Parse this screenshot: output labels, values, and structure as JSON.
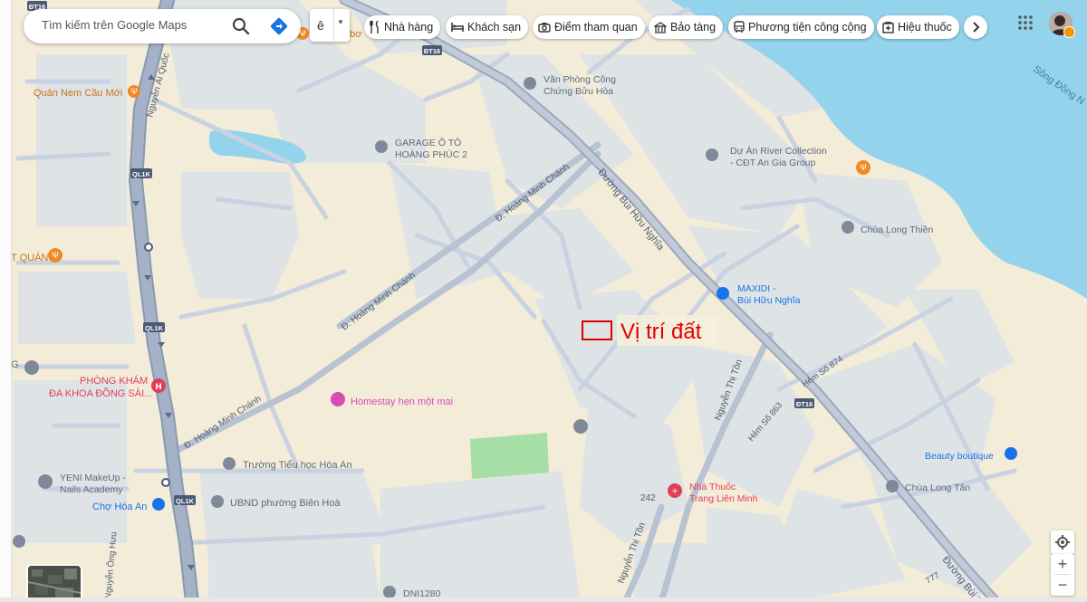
{
  "colors": {
    "land": "#f3ecd9",
    "block": "#dde3e6",
    "road": "#c9d2e0",
    "road_edge": "#b7c2d3",
    "highway": "#9aa8bd",
    "water": "#94d3ec",
    "park": "#a6dfa6",
    "poi_orange": "#f08a24",
    "poi_red": "#e23e57",
    "poi_blue": "#1a73e8",
    "poi_gray": "#7e8a99",
    "poi_pink": "#d84db3",
    "annotation": "#e00000"
  },
  "search": {
    "placeholder": "Tìm kiếm trên Google Maps"
  },
  "chips": [
    {
      "label": "Nhà hàng",
      "icon": "restaurant-icon"
    },
    {
      "label": "Khách sạn",
      "icon": "hotel-icon"
    },
    {
      "label": "Điểm tham quan",
      "icon": "camera-icon"
    },
    {
      "label": "Bảo tàng",
      "icon": "museum-icon"
    },
    {
      "label": "Phương tiện công cộng",
      "icon": "transit-icon"
    },
    {
      "label": "Hiệu thuốc",
      "icon": "pharmacy-icon"
    }
  ],
  "annotation": {
    "label": "Vị trí đất"
  },
  "river": {
    "name": "Sông Đồng N"
  },
  "roads": {
    "bui_huu_nghia": "Đường Bùi Hữu Nghĩa",
    "bui_huu_nghia_bottom": "Đường Bùi H",
    "hoang_minh_chanh_1": "Đ. Hoàng Minh Chánh",
    "hoang_minh_chanh_2": "Đ. Hoàng Minh Chánh",
    "hoang_minh_chanh_3": "Đ. Hoàng Minh Chánh",
    "nguyen_ai_quoc": "Nguyễn Ái Quốc",
    "nguyen_thi_ton_1": "Nguyễn Thị Tồn",
    "nguyen_thi_ton_2": "Nguyễn Thị Tồn",
    "hem_874": "Hẻm Số 874",
    "hem_863": "Hẻm Số 863",
    "left_road": "Nguyễn Ông Hưu",
    "num_242": "242",
    "num_777": "777"
  },
  "shields": {
    "dt16_a": "ĐT16",
    "dt16_b": "ĐT16",
    "dt16_c": "ĐT16",
    "ql1k_a": "QL1K",
    "ql1k_b": "QL1K",
    "ql1k_c": "QL1K"
  },
  "pois": {
    "quan_nem": "Quán Nem Cầu Mới",
    "bo": "bơ",
    "van_phong_1": "Văn Phòng Công",
    "van_phong_2": "Chứng Bửu Hòa",
    "garage_1": "GARAGE Ô TÔ",
    "garage_2": "HOÀNG PHÚC 2",
    "river_collection_1": "Dự Án River Collection",
    "river_collection_2": "- CĐT An Gia Group",
    "chua_long_thien": "Chùa Long Thiền",
    "quan_left": "T QUÁN",
    "maxidi_1": "MAXIDI -",
    "maxidi_2": "Bùi Hữu Nghĩa",
    "g_left": "G",
    "phong_kham_1": "PHÒNG KHÁM",
    "phong_kham_2": "ĐA KHOA ĐỒNG SÀI...",
    "homestay": "Homestay hẹn một mai",
    "beauty": "Beauty boutique",
    "yeni_1": "YENI MakeUp -",
    "yeni_2": "Nails Academy",
    "truong": "Trường Tiểu học Hóa An",
    "ubnd": "UBND phường Biên Hoà",
    "cho_hoa_an": "Chợ Hóa An",
    "nha_thuoc_1": "Nhà Thuốc",
    "nha_thuoc_2": "Trang Liên Minh",
    "chua_long_tan": "Chùa Long Tân",
    "dni": "DNI1280"
  },
  "controls": {
    "zoom_in": "+",
    "zoom_out": "−"
  }
}
